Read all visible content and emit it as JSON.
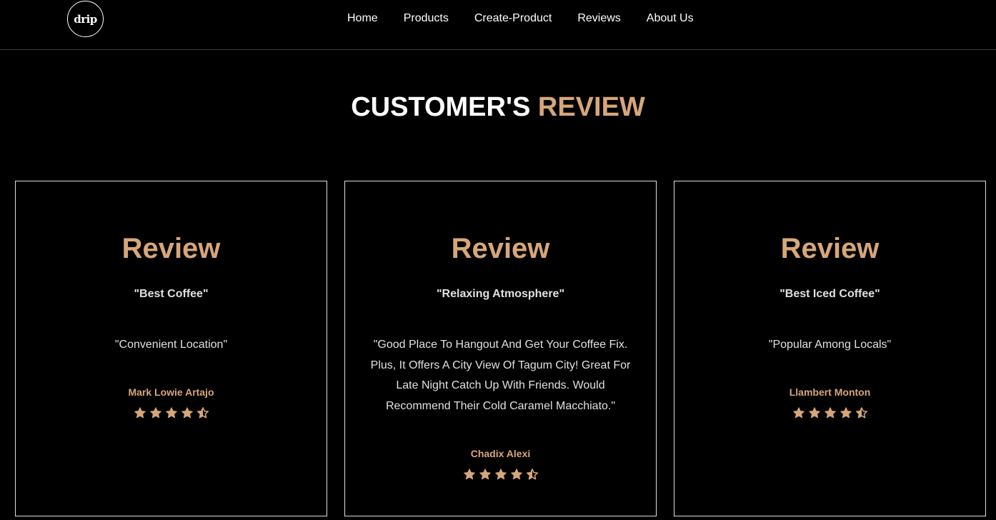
{
  "header": {
    "logo_text": "drip",
    "nav": [
      {
        "label": "Home"
      },
      {
        "label": "Products"
      },
      {
        "label": "Create-Product"
      },
      {
        "label": "Reviews"
      },
      {
        "label": "About Us"
      }
    ]
  },
  "section": {
    "title_main": "CUSTOMER'S",
    "title_accent": "REVIEW"
  },
  "reviews": [
    {
      "title": "Review",
      "subtitle": "\"Best Coffee\"",
      "body": "\"Convenient Location\"",
      "author": "Mark Lowie Artajo",
      "rating": 4.5
    },
    {
      "title": "Review",
      "subtitle": "\"Relaxing Atmosphere\"",
      "body": "\"Good Place To Hangout And Get Your Coffee Fix. Plus, It Offers A City View Of Tagum City! Great For Late Night Catch Up With Friends. Would Recommend Their Cold Caramel Macchiato.\"",
      "author": "Chadix Alexi",
      "rating": 4.5
    },
    {
      "title": "Review",
      "subtitle": "\"Best Iced Coffee\"",
      "body": "\"Popular Among Locals\"",
      "author": "Llambert Monton",
      "rating": 4.5
    }
  ],
  "colors": {
    "background": "#000000",
    "accent": "#d6a67a",
    "text": "#ffffff"
  },
  "icons": {
    "logo": "drip-logo",
    "star_full": "star-icon",
    "star_half": "star-half-icon"
  }
}
